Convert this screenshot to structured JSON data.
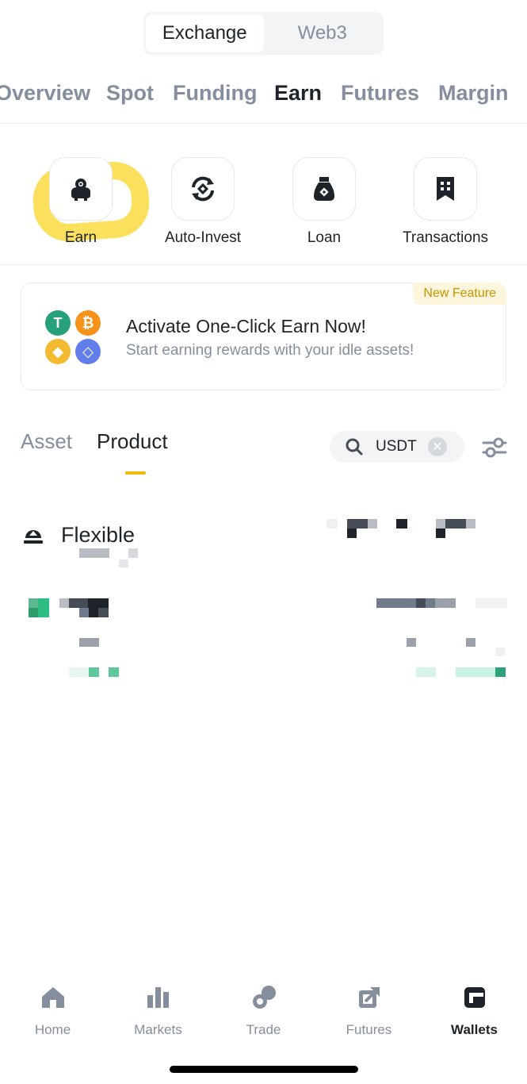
{
  "segment": {
    "options": [
      "Exchange",
      "Web3"
    ],
    "active": "Exchange"
  },
  "account_tabs": [
    "Overview",
    "Spot",
    "Funding",
    "Earn",
    "Futures",
    "Margin"
  ],
  "account_tab_active": "Earn",
  "quick_actions": [
    {
      "label": "Earn",
      "icon": "piggy-bank-icon"
    },
    {
      "label": "Auto-Invest",
      "icon": "auto-invest-icon"
    },
    {
      "label": "Loan",
      "icon": "loan-bag-icon"
    },
    {
      "label": "Transactions",
      "icon": "receipt-icon"
    }
  ],
  "banner": {
    "badge": "New Feature",
    "title": "Activate One-Click Earn Now!",
    "subtitle": "Start earning rewards with your idle assets!",
    "coins": [
      "usdt-coin-icon",
      "btc-coin-icon",
      "bnb-coin-icon",
      "eth-coin-icon"
    ]
  },
  "sub_tabs": [
    "Asset",
    "Product"
  ],
  "sub_tab_active": "Product",
  "search": {
    "value": "USDT"
  },
  "section": {
    "label": "Flexible"
  },
  "bottom_nav": [
    {
      "label": "Home",
      "icon": "home-icon"
    },
    {
      "label": "Markets",
      "icon": "markets-icon"
    },
    {
      "label": "Trade",
      "icon": "trade-icon"
    },
    {
      "label": "Futures",
      "icon": "futures-icon"
    },
    {
      "label": "Wallets",
      "icon": "wallet-icon"
    }
  ],
  "bottom_nav_active": "Wallets",
  "colors": {
    "accent": "#f0b90b",
    "text": "#1e2329",
    "muted": "#848e9c",
    "positive": "#2ebd85"
  }
}
